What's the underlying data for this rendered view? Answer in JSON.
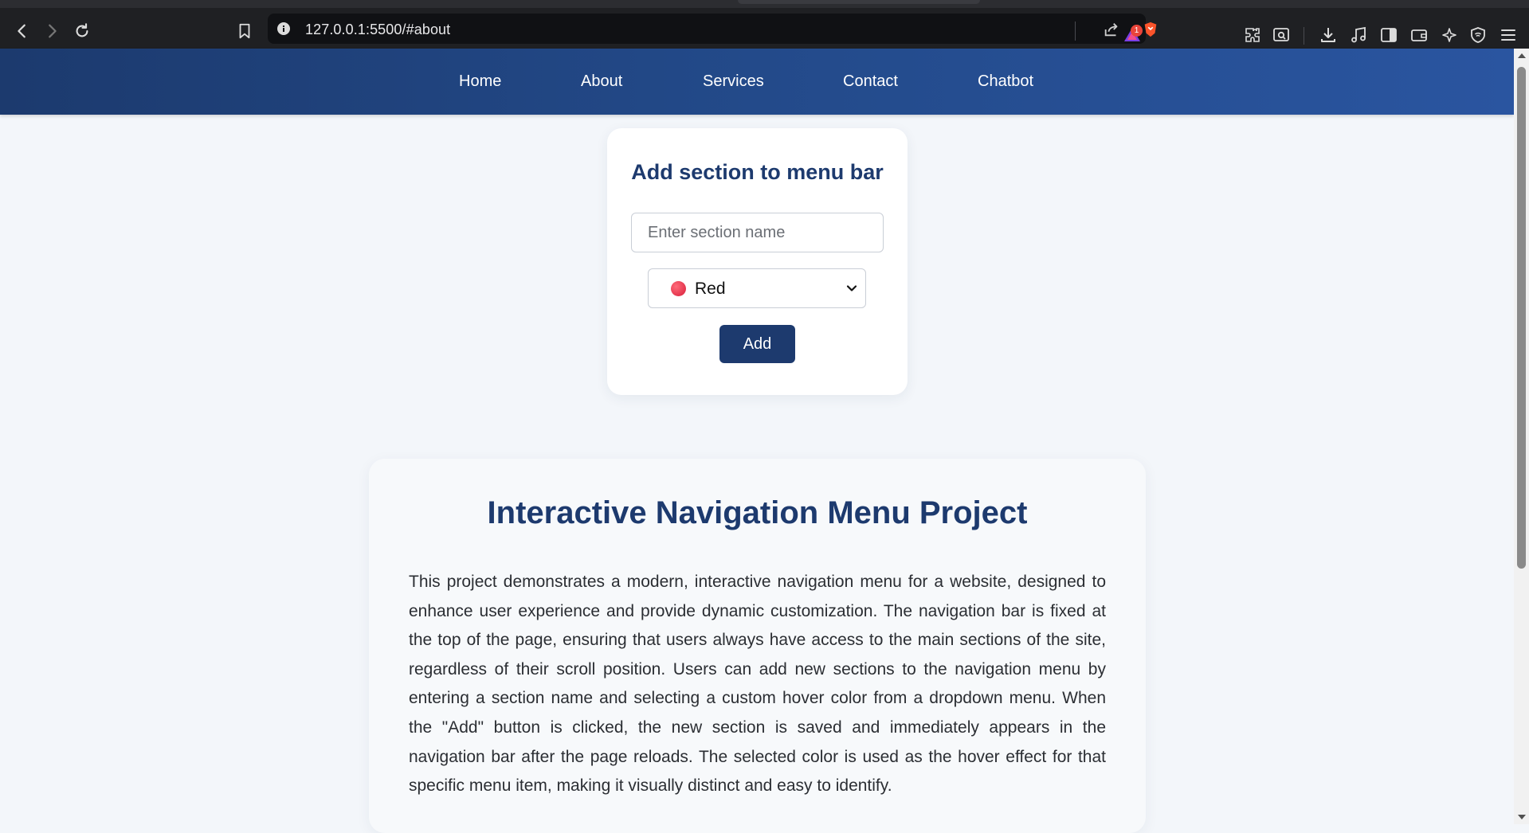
{
  "browser": {
    "url": "127.0.0.1:5500/#about",
    "notification_count": "1"
  },
  "nav": {
    "items": [
      "Home",
      "About",
      "Services",
      "Contact",
      "Chatbot"
    ]
  },
  "add_section": {
    "title": "Add section to menu bar",
    "input_placeholder": "Enter section name",
    "input_value": "",
    "color_selected": "Red",
    "color_selected_hex": "#e0283f",
    "add_label": "Add"
  },
  "about": {
    "title": "Interactive Navigation Menu Project",
    "body": "This project demonstrates a modern, interactive navigation menu for a website, designed to enhance user experience and provide dynamic customization. The navigation bar is fixed at the top of the page, ensuring that users always have access to the main sections of the site, regardless of their scroll position. Users can add new sections to the navigation menu by entering a section name and selecting a custom hover color from a dropdown menu. When the \"Add\" button is clicked, the new section is saved and immediately appears in the navigation bar after the page reloads. The selected color is used as the hover effect for that specific menu item, making it visually distinct and easy to identify."
  },
  "colors": {
    "nav_start": "#1c3a6e",
    "nav_end": "#2a55a0",
    "heading": "#1d3a6e",
    "page_bg": "#f3f6fa"
  }
}
